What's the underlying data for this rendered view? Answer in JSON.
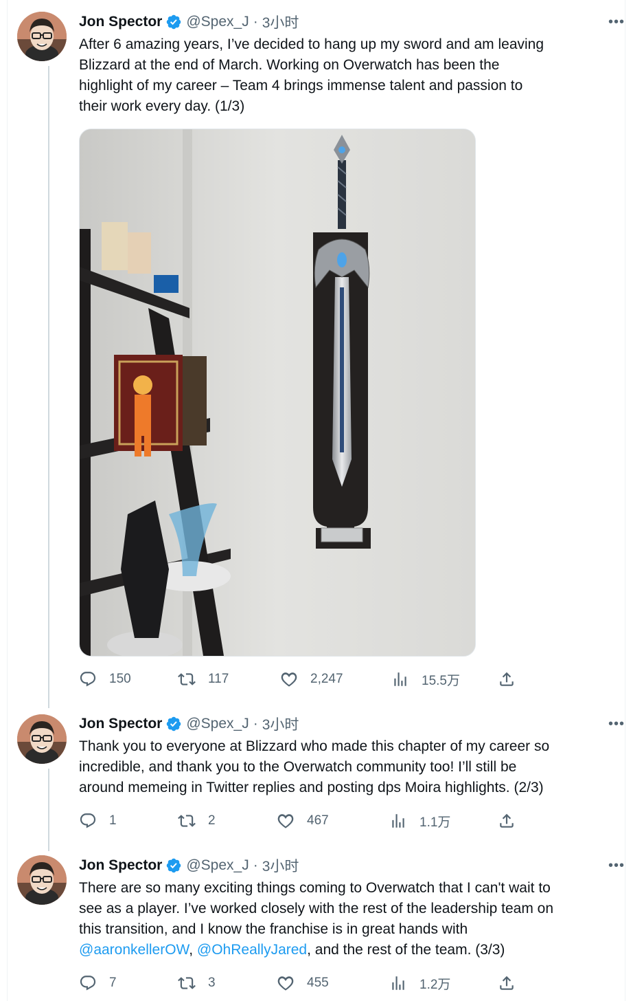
{
  "tweets": [
    {
      "author": "Jon Spector",
      "handle": "@Spex_J",
      "separator": "·",
      "time": "3小时",
      "more_label": "•••",
      "lines": [
        "After 6 amazing years, I’ve decided to hang up my sword and am leaving",
        "Blizzard at the end of March. Working on Overwatch has been the",
        "highlight of my career – Team 4 brings immense talent and passion to",
        "their work every day. (1/3)"
      ],
      "media": "photo-sword-on-wall-with-figurine-shelves",
      "replies": "150",
      "retweets": "117",
      "likes": "2,247",
      "views": "15.5万"
    },
    {
      "author": "Jon Spector",
      "handle": "@Spex_J",
      "separator": "·",
      "time": "3小时",
      "more_label": "•••",
      "lines": [
        "Thank you to everyone at Blizzard who made this chapter of my career so",
        "incredible, and thank you to the Overwatch community too! I’ll still be",
        "around memeing in Twitter replies and posting dps Moira highlights. (2/3)"
      ],
      "replies": "1",
      "retweets": "2",
      "likes": "467",
      "views": "1.1万"
    },
    {
      "author": "Jon Spector",
      "handle": "@Spex_J",
      "separator": "·",
      "time": "3小时",
      "more_label": "•••",
      "lines": [
        "There are so many exciting things coming to Overwatch that I can't wait to",
        "see as a player. I’ve worked closely with the rest of the leadership team on",
        "this transition, and I know the franchise is in great hands with"
      ],
      "last_line": {
        "mention1": "@aaronkellerOW",
        "comma": ", ",
        "mention2": "@OhReallyJared",
        "rest": ", and the rest of the team. (3/3)"
      },
      "replies": "7",
      "retweets": "3",
      "likes": "455",
      "views": "1.2万"
    }
  ],
  "colors": {
    "text": "#0f1419",
    "secondary": "#536471",
    "link": "#1d9bf0",
    "verified": "#1d9bf0",
    "thread_line": "#cfd9de"
  },
  "icons": [
    "verified-badge-icon",
    "more-icon",
    "reply-icon",
    "retweet-icon",
    "like-icon",
    "views-icon",
    "share-icon"
  ]
}
